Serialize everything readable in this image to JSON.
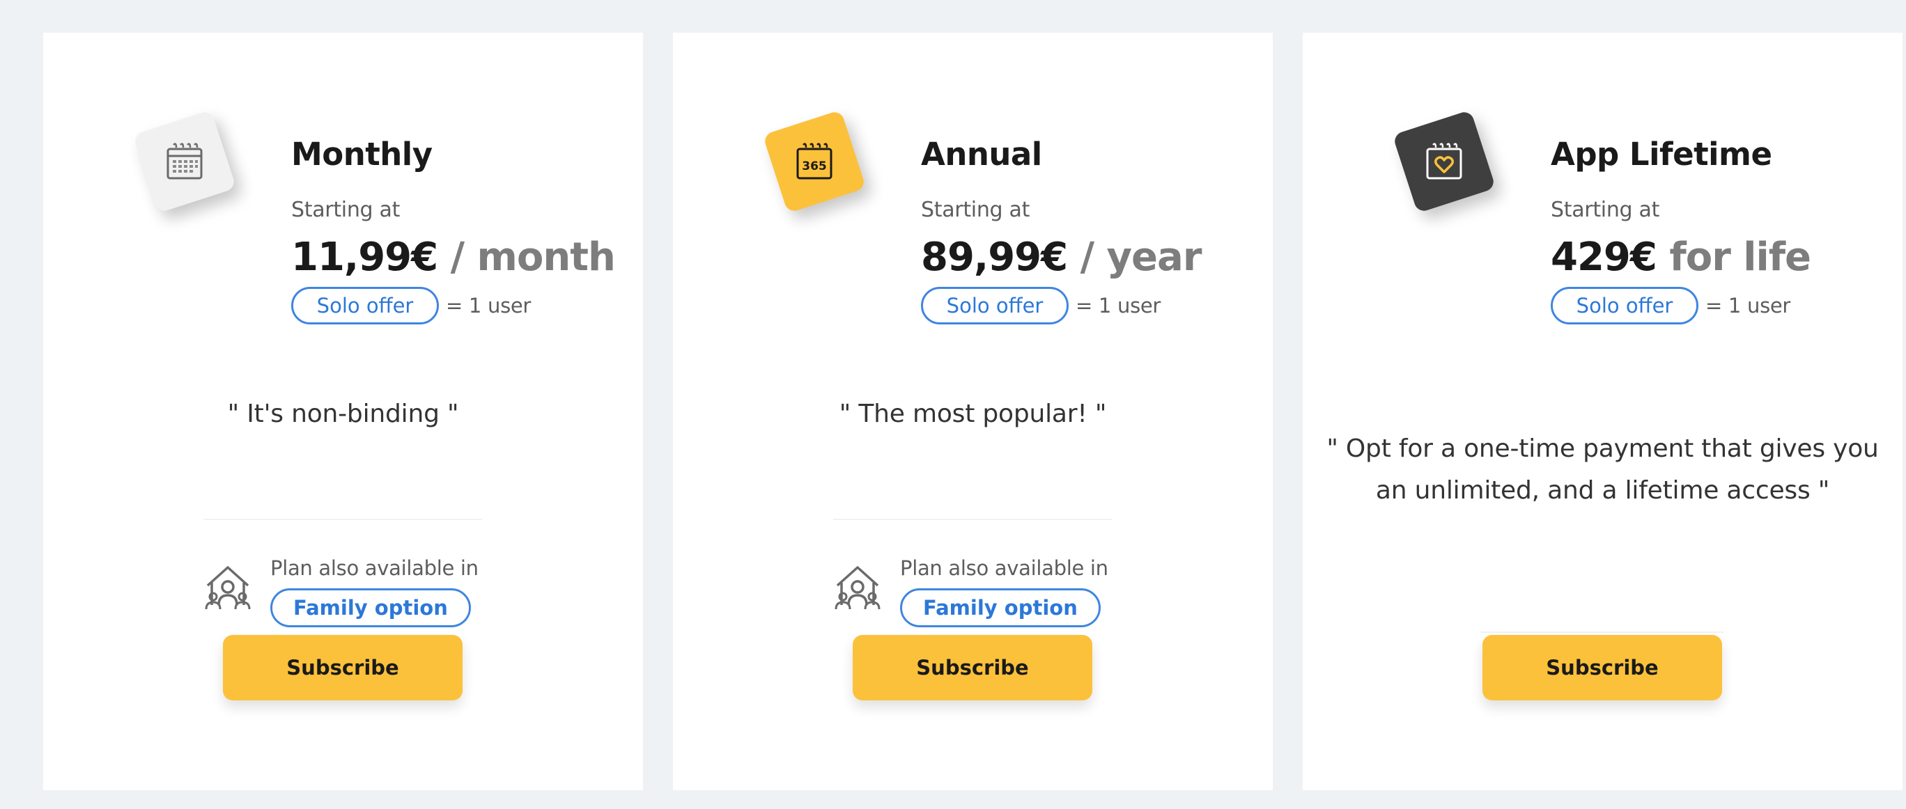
{
  "plans": [
    {
      "title": "Monthly",
      "starting_label": "Starting at",
      "price": "11,99€",
      "period": " / month",
      "offer_label": "Solo offer",
      "users_label": "= 1 user",
      "quote": "\" It's non-binding \"",
      "family_text": "Plan also available in",
      "family_option_label": "Family option",
      "subscribe_label": "Subscribe",
      "icon": "calendar-icon"
    },
    {
      "title": "Annual",
      "starting_label": "Starting at",
      "price": "89,99€",
      "period": " / year",
      "offer_label": "Solo offer",
      "users_label": "= 1 user",
      "quote": "\" The most popular! \"",
      "family_text": "Plan also available in",
      "family_option_label": "Family option",
      "subscribe_label": "Subscribe",
      "icon": "calendar-365-icon",
      "icon_text": "365"
    },
    {
      "title": "App Lifetime",
      "starting_label": "Starting at",
      "price": "429€",
      "period": " for life",
      "offer_label": "Solo offer",
      "users_label": "= 1 user",
      "quote": "\" Opt for a one-time payment that gives you an unlimited, and a lifetime access \"",
      "subscribe_label": "Subscribe",
      "icon": "calendar-heart-icon"
    }
  ],
  "colors": {
    "accent_yellow": "#fcc13b",
    "pill_blue": "#3e86e0",
    "background": "#eef2f5"
  }
}
